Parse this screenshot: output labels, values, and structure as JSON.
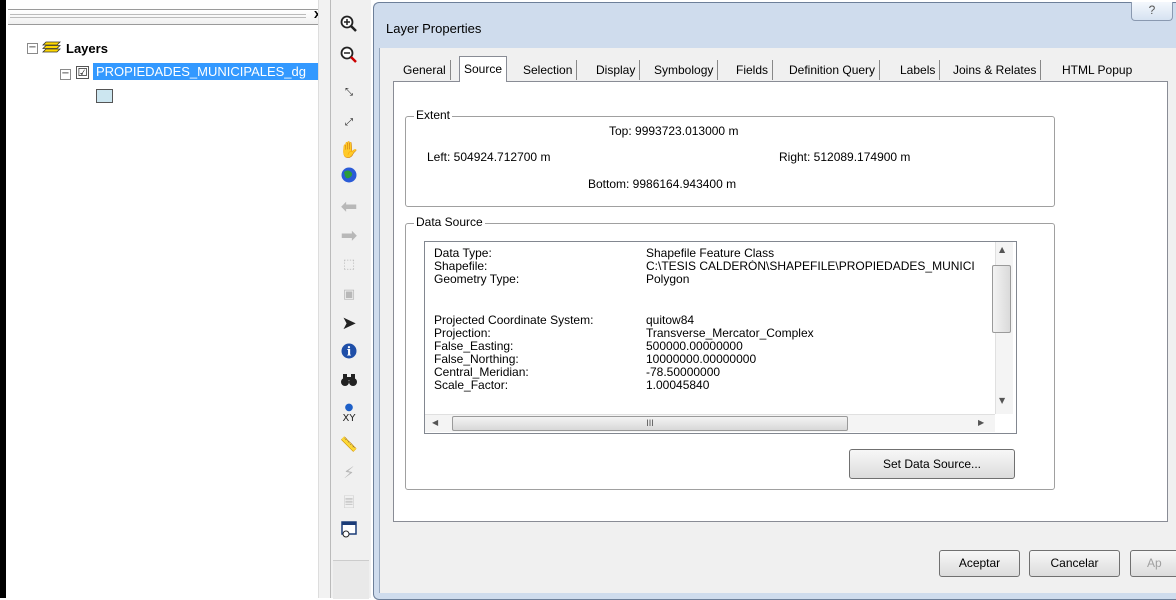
{
  "toc": {
    "close_glyph": "x",
    "root_label": "Layers",
    "layer_name": "PROPIEDADES_MUNICIPALES_dg",
    "checkbox_glyph": "☑"
  },
  "toolbar": {
    "tools": [
      "zoom-in",
      "zoom-out",
      "fixed-zoom-in",
      "fixed-zoom-out",
      "pan",
      "full-extent",
      "back",
      "forward",
      "select-elements",
      "clear-selection",
      "select",
      "identify",
      "find",
      "go-to-xy",
      "measure",
      "hyperlink",
      "html-popup",
      "time-slider"
    ]
  },
  "dialog": {
    "title": "Layer Properties",
    "help_glyph": "?",
    "tabs": [
      "General",
      "Source",
      "Selection",
      "Display",
      "Symbology",
      "Fields",
      "Definition Query",
      "Labels",
      "Joins & Relates",
      "HTML Popup"
    ],
    "active_tab": "Source",
    "extent": {
      "label": "Extent",
      "top": "Top:  9993723.013000 m",
      "left": "Left:  504924.712700 m",
      "right": "Right:  512089.174900 m",
      "bottom": "Bottom:  9986164.943400 m"
    },
    "data_source": {
      "label": "Data Source",
      "rows": [
        {
          "key": "Data Type:",
          "value": "Shapefile Feature Class"
        },
        {
          "key": "Shapefile:",
          "value": "C:\\TESIS CALDERÓN\\SHAPEFILE\\PROPIEDADES_MUNICI"
        },
        {
          "key": "Geometry Type:",
          "value": "Polygon"
        },
        {
          "key": "Projected Coordinate System:",
          "value": "quitow84"
        },
        {
          "key": "Projection:",
          "value": "Transverse_Mercator_Complex"
        },
        {
          "key": "False_Easting:",
          "value": "500000.00000000"
        },
        {
          "key": "False_Northing:",
          "value": "10000000.00000000"
        },
        {
          "key": "Central_Meridian:",
          "value": "-78.50000000"
        },
        {
          "key": "Scale_Factor:",
          "value": "1.00045840"
        }
      ],
      "hscroll_glyph": "III",
      "set_button": "Set Data Source..."
    },
    "buttons": {
      "ok": "Aceptar",
      "cancel": "Cancelar",
      "apply": "Ap"
    }
  }
}
